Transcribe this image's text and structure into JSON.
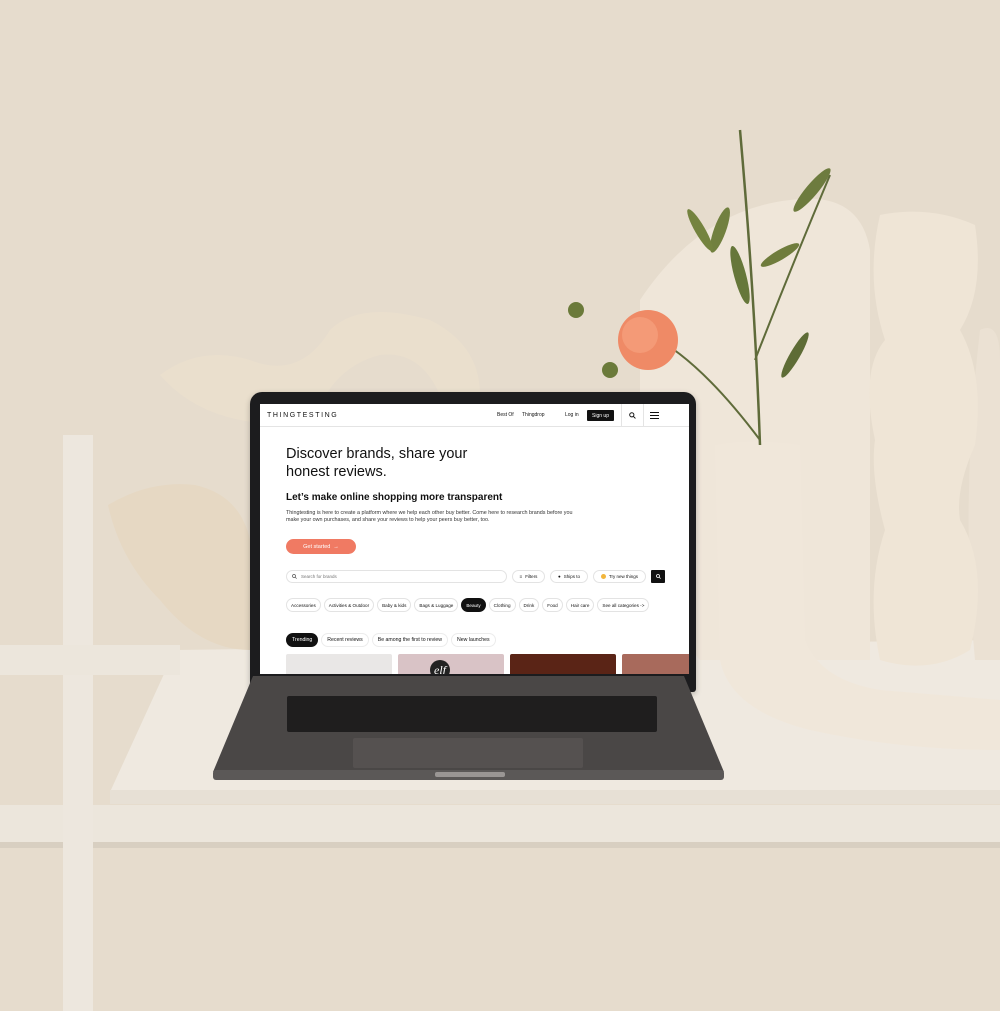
{
  "site": {
    "logo": "THINGTESTING",
    "nav": {
      "best_of": "Best Of",
      "thingdrop": "Thingdrop",
      "login": "Log in",
      "signup": "Sign up"
    }
  },
  "hero": {
    "title": "Discover brands, share your honest reviews.",
    "subtitle": "Let’s make online shopping more transparent",
    "description": "Thingtesting is here to create a platform where we help each other buy better. Come here to research brands before you make your own purchases, and share your reviews to help your peers buy better, too.",
    "cta": "Get started"
  },
  "search": {
    "placeholder": "Search for brands",
    "filters": "Filters",
    "ships_to": "Ships to",
    "try_new": "Try new things"
  },
  "categories": [
    {
      "label": "Accessories",
      "active": false
    },
    {
      "label": "Activities & Outdoor",
      "active": false
    },
    {
      "label": "Baby & kids",
      "active": false
    },
    {
      "label": "Bags & Luggage",
      "active": false
    },
    {
      "label": "Beauty",
      "active": true
    },
    {
      "label": "Clothing",
      "active": false
    },
    {
      "label": "Drink",
      "active": false
    },
    {
      "label": "Food",
      "active": false
    },
    {
      "label": "Hair care",
      "active": false
    },
    {
      "label": "See all categories ->",
      "active": false
    }
  ],
  "tabs": [
    {
      "label": "Trending",
      "active": true
    },
    {
      "label": "Recent reviews",
      "active": false
    },
    {
      "label": "Be among the first to review",
      "active": false
    },
    {
      "label": "New launches",
      "active": false
    }
  ],
  "cards": [
    {
      "name": "product-card-1",
      "color": "#e9e7e6"
    },
    {
      "name": "product-card-2",
      "color": "#d9c3c6",
      "text": "elf"
    },
    {
      "name": "product-card-3",
      "color": "#5a2416"
    },
    {
      "name": "product-card-4",
      "color": "#a86a5c"
    }
  ],
  "colors": {
    "accent": "#f07a63",
    "dark": "#111111"
  }
}
